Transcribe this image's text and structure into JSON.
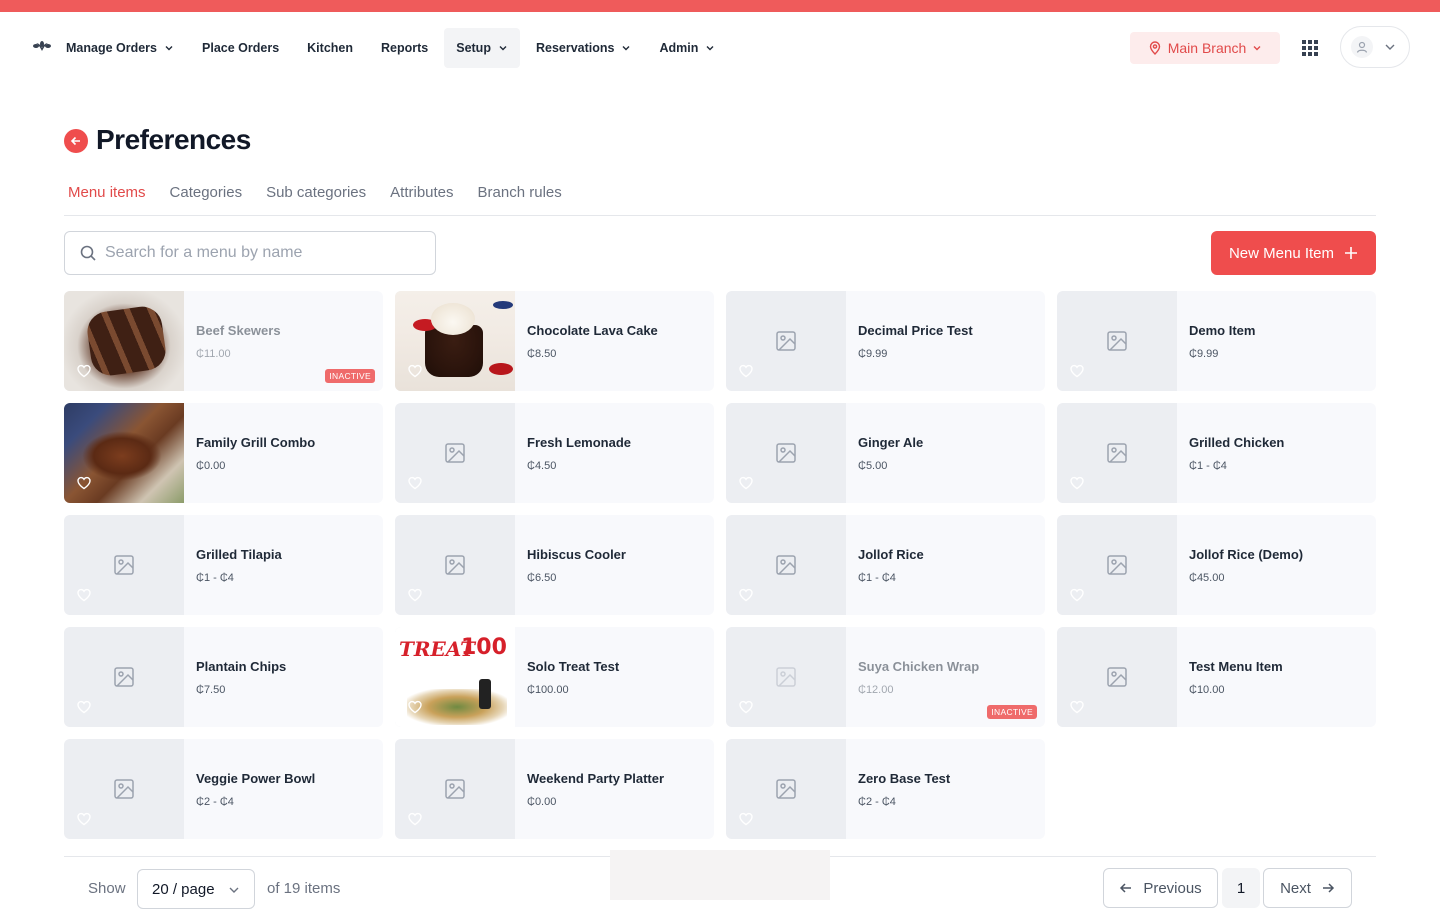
{
  "nav": {
    "items": [
      {
        "label": "Manage Orders",
        "dropdown": true,
        "active": false
      },
      {
        "label": "Place Orders",
        "dropdown": false,
        "active": false
      },
      {
        "label": "Kitchen",
        "dropdown": false,
        "active": false
      },
      {
        "label": "Reports",
        "dropdown": false,
        "active": false
      },
      {
        "label": "Setup",
        "dropdown": true,
        "active": true
      },
      {
        "label": "Reservations",
        "dropdown": true,
        "active": false
      },
      {
        "label": "Admin",
        "dropdown": true,
        "active": false
      }
    ],
    "branch": "Main Branch"
  },
  "page": {
    "title": "Preferences",
    "tabs": [
      "Menu items",
      "Categories",
      "Sub categories",
      "Attributes",
      "Branch rules"
    ],
    "active_tab": "Menu items"
  },
  "search": {
    "placeholder": "Search for a menu by name",
    "value": ""
  },
  "new_button": "New Menu Item",
  "inactive_badge": "INACTIVE",
  "menu_items": [
    {
      "name": "Beef Skewers",
      "price": "₵11.00",
      "inactive": true,
      "photo": "skewers"
    },
    {
      "name": "Chocolate Lava Cake",
      "price": "₵8.50",
      "inactive": false,
      "photo": "cake"
    },
    {
      "name": "Decimal Price Test",
      "price": "₵9.99",
      "inactive": false,
      "photo": null
    },
    {
      "name": "Demo Item",
      "price": "₵9.99",
      "inactive": false,
      "photo": null
    },
    {
      "name": "Family Grill Combo",
      "price": "₵0.00",
      "inactive": false,
      "photo": "combo"
    },
    {
      "name": "Fresh Lemonade",
      "price": "₵4.50",
      "inactive": false,
      "photo": null
    },
    {
      "name": "Ginger Ale",
      "price": "₵5.00",
      "inactive": false,
      "photo": null
    },
    {
      "name": "Grilled Chicken",
      "price": "₵1 - ₵4",
      "inactive": false,
      "photo": null
    },
    {
      "name": "Grilled Tilapia",
      "price": "₵1 - ₵4",
      "inactive": false,
      "photo": null
    },
    {
      "name": "Hibiscus Cooler",
      "price": "₵6.50",
      "inactive": false,
      "photo": null
    },
    {
      "name": "Jollof Rice",
      "price": "₵1 - ₵4",
      "inactive": false,
      "photo": null
    },
    {
      "name": "Jollof Rice (Demo)",
      "price": "₵45.00",
      "inactive": false,
      "photo": null
    },
    {
      "name": "Plantain Chips",
      "price": "₵7.50",
      "inactive": false,
      "photo": null
    },
    {
      "name": "Solo Treat Test",
      "price": "₵100.00",
      "inactive": false,
      "photo": "solo"
    },
    {
      "name": "Suya Chicken Wrap",
      "price": "₵12.00",
      "inactive": true,
      "photo": null
    },
    {
      "name": "Test Menu Item",
      "price": "₵10.00",
      "inactive": false,
      "photo": null
    },
    {
      "name": "Veggie Power Bowl",
      "price": "₵2 - ₵4",
      "inactive": false,
      "photo": null
    },
    {
      "name": "Weekend Party Platter",
      "price": "₵0.00",
      "inactive": false,
      "photo": null
    },
    {
      "name": "Zero Base Test",
      "price": "₵2 - ₵4",
      "inactive": false,
      "photo": null
    }
  ],
  "solo_photo_text": {
    "title": "TREAT",
    "price": "100"
  },
  "pagination": {
    "show_label": "Show",
    "per_page": "20 / page",
    "total": "of 19 items",
    "previous": "Previous",
    "current_page": "1",
    "next": "Next"
  },
  "colors": {
    "brand": "#ef4d4d",
    "brand_light": "#fdecec",
    "card_bg": "#f8f9fc"
  }
}
